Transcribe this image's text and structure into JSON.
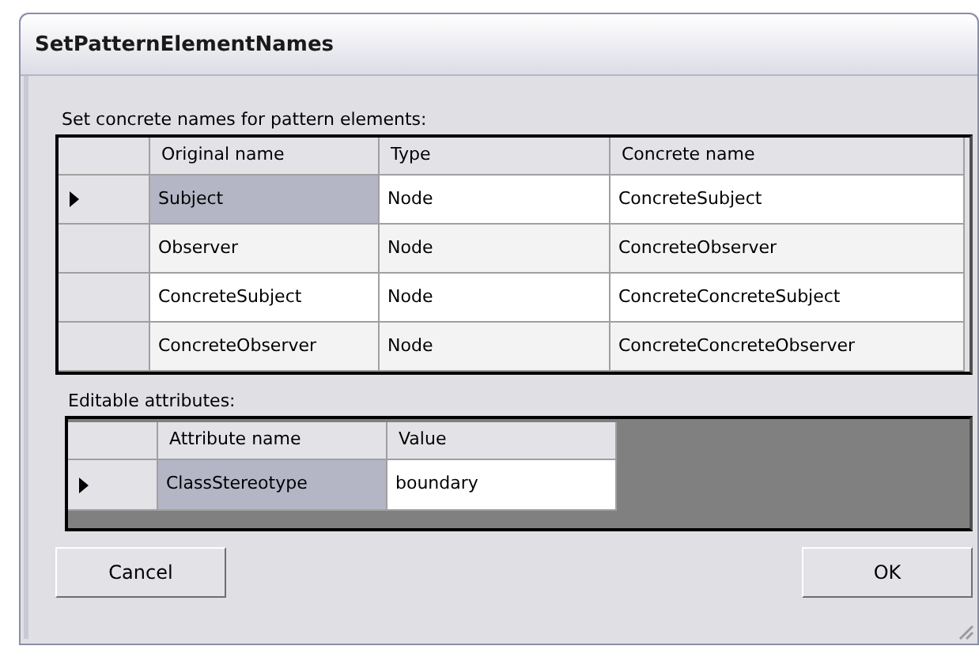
{
  "window": {
    "title": "SetPatternElementNames"
  },
  "names_label": "Set concrete names for pattern elements:",
  "names_table": {
    "columns": [
      "Original name",
      "Type",
      "Concrete name"
    ],
    "rows": [
      {
        "cells": [
          "Subject",
          "Node",
          "ConcreteSubject"
        ],
        "selected": true
      },
      {
        "cells": [
          "Observer",
          "Node",
          "ConcreteObserver"
        ],
        "selected": false
      },
      {
        "cells": [
          "ConcreteSubject",
          "Node",
          "ConcreteConcreteSubject"
        ],
        "selected": false
      },
      {
        "cells": [
          "ConcreteObserver",
          "Node",
          "ConcreteConcreteObserver"
        ],
        "selected": false
      }
    ]
  },
  "attributes_label": "Editable attributes:",
  "attributes_table": {
    "columns": [
      "Attribute name",
      "Value"
    ],
    "rows": [
      {
        "cells": [
          "ClassStereotype",
          "boundary"
        ],
        "selected": true
      }
    ]
  },
  "buttons": {
    "cancel": "Cancel",
    "ok": "OK"
  }
}
